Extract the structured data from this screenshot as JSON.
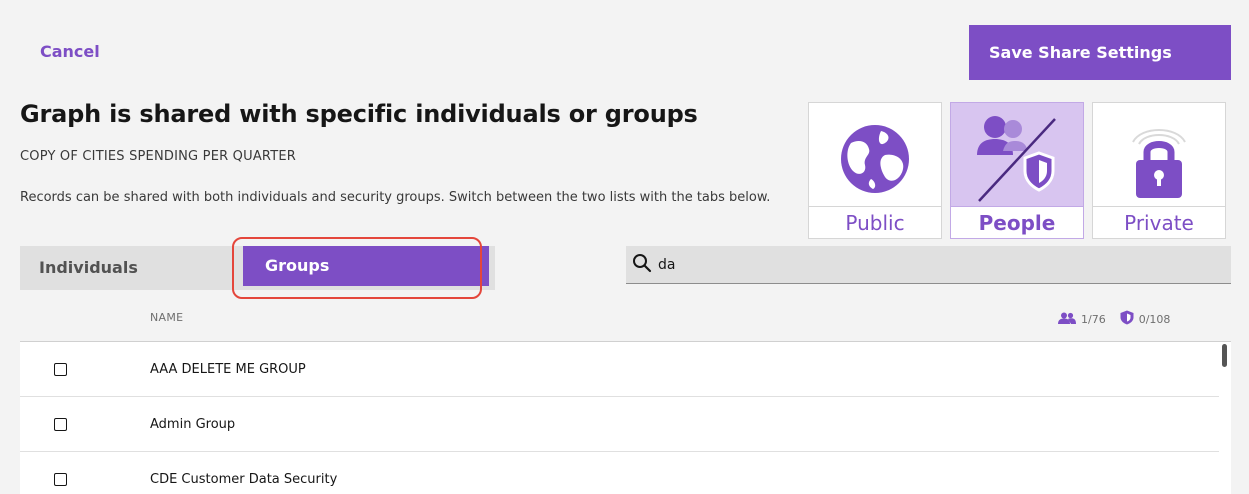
{
  "header": {
    "cancel_label": "Cancel",
    "save_label": "Save Share Settings"
  },
  "title": "Graph is shared with specific individuals or groups",
  "subtitle": "COPY OF CITIES SPENDING PER QUARTER",
  "description": "Records can be shared with both individuals and security groups. Switch between the two lists with the tabs below.",
  "share_options": [
    {
      "label": "Public",
      "icon": "globe-icon",
      "selected": false
    },
    {
      "label": "People",
      "icon": "people-shield-icon",
      "selected": true
    },
    {
      "label": "Private",
      "icon": "padlock-icon",
      "selected": false
    }
  ],
  "tabs": {
    "individuals_label": "Individuals",
    "groups_label": "Groups",
    "active": "Groups"
  },
  "search": {
    "value": "da",
    "icon": "search-icon"
  },
  "list": {
    "column_name": "NAME",
    "user_count": "1/76",
    "group_count": "0/108",
    "rows": [
      {
        "label": "AAA DELETE ME GROUP",
        "checked": false
      },
      {
        "label": "Admin Group",
        "checked": false
      },
      {
        "label": "CDE Customer Data Security",
        "checked": false
      }
    ]
  },
  "colors": {
    "accent": "#7d4ec5",
    "accent_light": "#d8c5f0",
    "highlight": "#e4463b"
  }
}
